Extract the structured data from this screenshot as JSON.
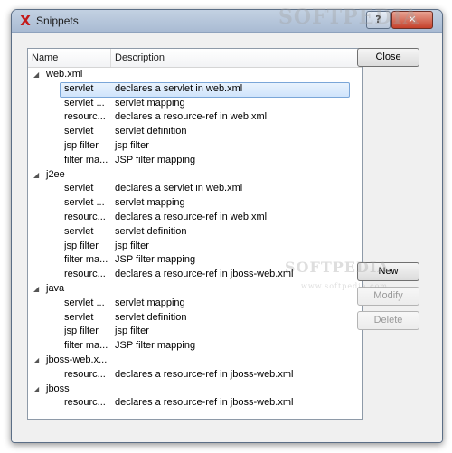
{
  "window": {
    "title": "Snippets",
    "help_label": "?",
    "close_label": "✕"
  },
  "tree": {
    "columns": [
      "Name",
      "Description"
    ],
    "groups": [
      {
        "name": "web.xml",
        "items": [
          {
            "name": "servlet",
            "description": "declares a servlet in web.xml",
            "selected": true
          },
          {
            "name": "servlet ...",
            "description": "servlet mapping"
          },
          {
            "name": "resourc...",
            "description": "declares a resource-ref in web.xml"
          },
          {
            "name": "servlet",
            "description": "servlet definition"
          },
          {
            "name": "jsp filter",
            "description": "jsp filter"
          },
          {
            "name": "filter ma...",
            "description": "JSP filter mapping"
          }
        ]
      },
      {
        "name": "j2ee",
        "items": [
          {
            "name": "servlet",
            "description": "declares a servlet in web.xml"
          },
          {
            "name": "servlet ...",
            "description": "servlet mapping"
          },
          {
            "name": "resourc...",
            "description": "declares a resource-ref in web.xml"
          },
          {
            "name": "servlet",
            "description": "servlet definition"
          },
          {
            "name": "jsp filter",
            "description": "jsp filter"
          },
          {
            "name": "filter ma...",
            "description": "JSP filter mapping"
          },
          {
            "name": "resourc...",
            "description": "declares a resource-ref in jboss-web.xml"
          }
        ]
      },
      {
        "name": "java",
        "items": [
          {
            "name": "servlet ...",
            "description": "servlet mapping"
          },
          {
            "name": "servlet",
            "description": "servlet definition"
          },
          {
            "name": "jsp filter",
            "description": "jsp filter"
          },
          {
            "name": "filter ma...",
            "description": "JSP filter mapping"
          }
        ]
      },
      {
        "name": "jboss-web.x...",
        "items": [
          {
            "name": "resourc...",
            "description": "declares a resource-ref in jboss-web.xml"
          }
        ]
      },
      {
        "name": "jboss",
        "items": [
          {
            "name": "resourc...",
            "description": "declares a resource-ref in jboss-web.xml"
          }
        ]
      }
    ]
  },
  "buttons": {
    "close": "Close",
    "new": "New",
    "modify": "Modify",
    "delete": "Delete"
  },
  "watermark": {
    "top": "SOFTPEDIA",
    "middle": "SOFTPEDIA",
    "url": "www.softpedia.com"
  }
}
